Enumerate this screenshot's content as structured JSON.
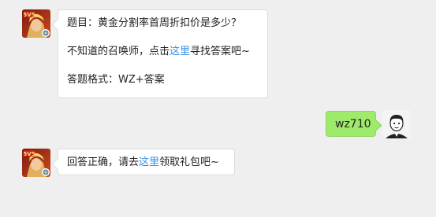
{
  "messages": [
    {
      "sender": "bot",
      "question_line": "题目：黄金分割率首周折扣价是多少？",
      "hint_prefix": "不知道的召唤师，点击",
      "hint_link": "这里",
      "hint_suffix": "寻找答案吧~",
      "format_line": "答题格式：WZ+答案"
    },
    {
      "sender": "user",
      "text": "wz710"
    },
    {
      "sender": "bot",
      "reply_prefix": "回答正确，请去",
      "reply_link": "这里",
      "reply_suffix": "领取礼包吧~"
    }
  ],
  "colors": {
    "background": "#efefef",
    "user_bubble": "#9eea6a",
    "link": "#3a8ee6"
  }
}
